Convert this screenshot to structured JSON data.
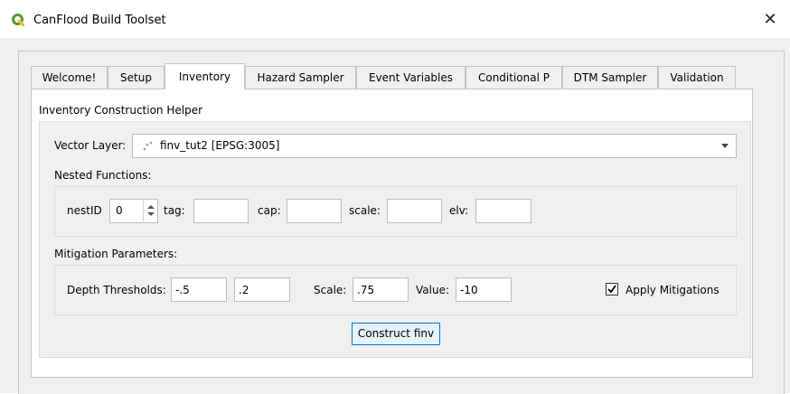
{
  "window": {
    "title": "CanFlood Build Toolset"
  },
  "tabs": [
    {
      "label": "Welcome!"
    },
    {
      "label": "Setup"
    },
    {
      "label": "Inventory"
    },
    {
      "label": "Hazard Sampler"
    },
    {
      "label": "Event Variables"
    },
    {
      "label": "Conditional P"
    },
    {
      "label": "DTM Sampler"
    },
    {
      "label": "Validation"
    }
  ],
  "active_tab": "Inventory",
  "inventory": {
    "section_title": "Inventory Construction Helper",
    "vector_layer": {
      "label": "Vector Layer:",
      "value": "finv_tut2 [EPSG:3005]"
    },
    "nested": {
      "label": "Nested Functions:",
      "nestid_label": "nestID",
      "nestid_value": "0",
      "tag_label": "tag:",
      "tag_value": "",
      "cap_label": "cap:",
      "cap_value": "",
      "scale_label": "scale:",
      "scale_value": "",
      "elv_label": "elv:",
      "elv_value": ""
    },
    "mitigation": {
      "label": "Mitigation Parameters:",
      "depth_label": "Depth Thresholds:",
      "depth_low": "-.5",
      "depth_high": ".2",
      "scale_label": "Scale:",
      "scale_value": ".75",
      "value_label": "Value:",
      "value_value": "-10",
      "apply_label": "Apply Mitigations",
      "apply_checked": true
    },
    "construct_button": "Construct finv"
  },
  "colors": {
    "accent": "#0078d7",
    "qgis_green": "#589632",
    "qgis_yellow": "#f0c419"
  },
  "icons": {
    "app": "qgis-logo-icon",
    "layer": "point-layer-icon",
    "close": "close-icon",
    "dropdown": "chevron-down-icon"
  }
}
